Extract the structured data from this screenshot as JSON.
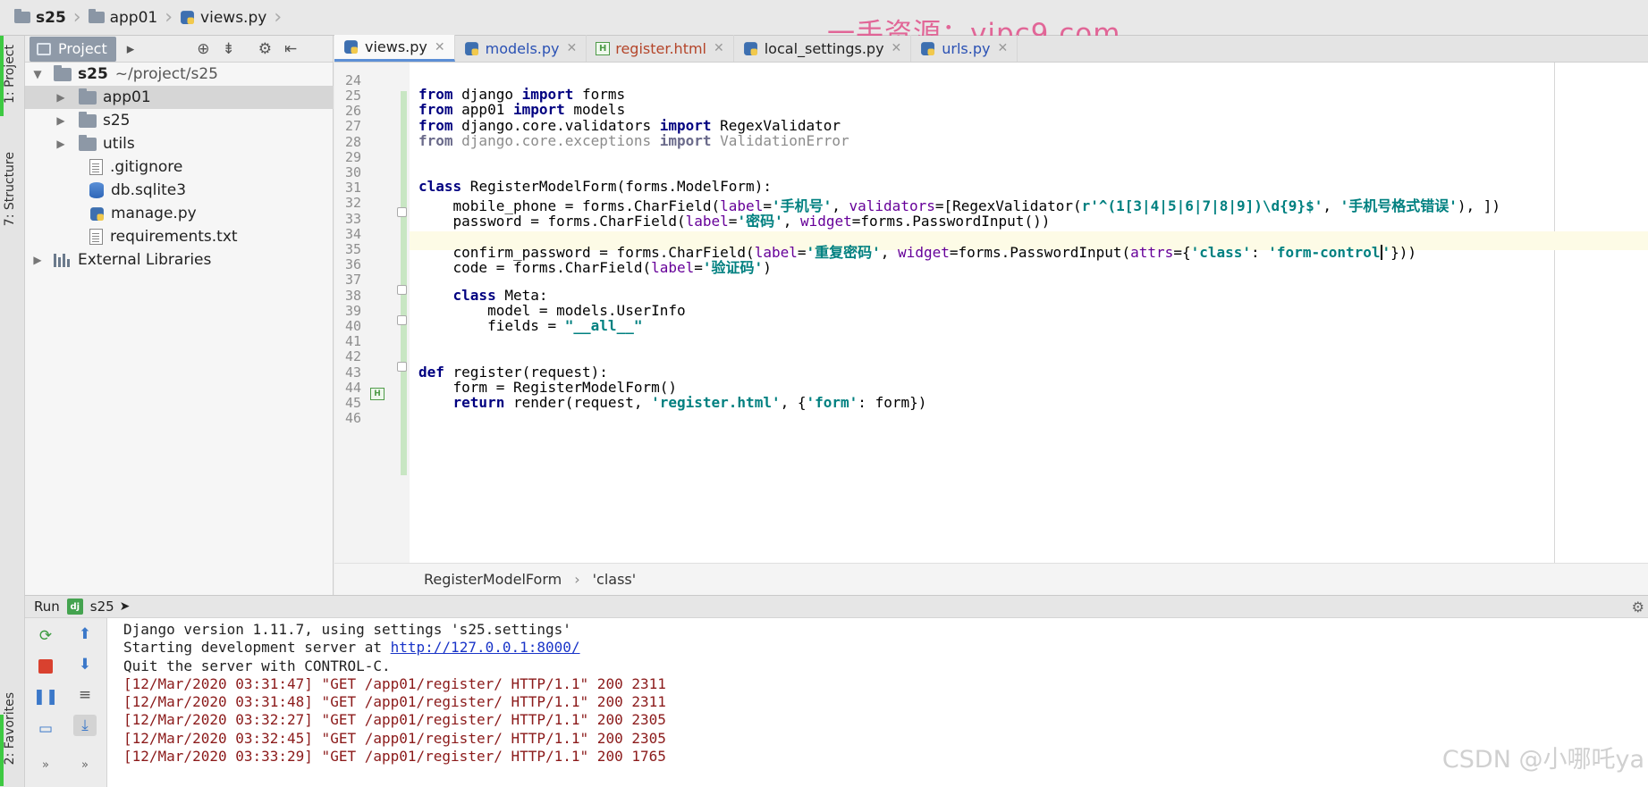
{
  "breadcrumb": {
    "items": [
      "s25",
      "app01",
      "views.py"
    ]
  },
  "watermark": "一手资源：vipc9.com",
  "side_tabs": {
    "project": "1: Project",
    "structure": "7: Structure",
    "favorites": "2: Favorites"
  },
  "project_panel": {
    "title": "Project",
    "root": {
      "name": "s25",
      "path": "~/project/s25"
    },
    "items": [
      {
        "name": "app01",
        "type": "folder"
      },
      {
        "name": "s25",
        "type": "folder"
      },
      {
        "name": "utils",
        "type": "folder"
      },
      {
        "name": ".gitignore",
        "type": "file"
      },
      {
        "name": "db.sqlite3",
        "type": "db"
      },
      {
        "name": "manage.py",
        "type": "python"
      },
      {
        "name": "requirements.txt",
        "type": "file"
      }
    ],
    "external": "External Libraries"
  },
  "editor_tabs": [
    {
      "label": "views.py",
      "active": true
    },
    {
      "label": "models.py",
      "active": false
    },
    {
      "label": "register.html",
      "active": false
    },
    {
      "label": "local_settings.py",
      "active": false
    },
    {
      "label": "urls.py",
      "active": false
    }
  ],
  "line_numbers": [
    "24",
    "25",
    "26",
    "27",
    "28",
    "29",
    "30",
    "31",
    "32",
    "33",
    "34",
    "35",
    "36",
    "37",
    "38",
    "39",
    "40",
    "41",
    "42",
    "43",
    "44",
    "45",
    "46"
  ],
  "code": {
    "l25": [
      "from",
      " django ",
      "import",
      " forms"
    ],
    "l26": [
      "from",
      " app01 ",
      "import",
      " models"
    ],
    "l27": [
      "from",
      " django.core.validators ",
      "import",
      " RegexValidator"
    ],
    "l28": [
      "from",
      " django.core.exceptions ",
      "import",
      " ValidationError"
    ],
    "l31": [
      "class",
      " RegisterModelForm(forms.ModelForm):"
    ],
    "l32": [
      "    mobile_phone = forms.CharField(",
      "label",
      "=",
      "'手机号'",
      ", ",
      "validators",
      "=[RegexValidator(",
      "r'^(1[3|4|5|6|7|8|9])\\d{9}$'",
      ", ",
      "'手机号格式错误'",
      "), ])"
    ],
    "l33": [
      "    password = forms.CharField(",
      "label",
      "=",
      "'密码'",
      ", ",
      "widget",
      "=forms.PasswordInput())"
    ],
    "l35": [
      "    confirm_password = forms.CharField(",
      "label",
      "=",
      "'重复密码'",
      ", ",
      "widget",
      "=forms.PasswordInput(",
      "attrs",
      "={",
      "'class'",
      ": ",
      "'form-control",
      "'",
      "}))"
    ],
    "l36": [
      "    code = forms.CharField(",
      "label",
      "=",
      "'验证码'",
      ")"
    ],
    "l38": [
      "    ",
      "class",
      " Meta:"
    ],
    "l39": [
      "        model = models.UserInfo"
    ],
    "l40": [
      "        fields = ",
      "\"__all__\""
    ],
    "l43": [
      "def",
      " register(request):"
    ],
    "l44": [
      "    form = RegisterModelForm()"
    ],
    "l45": [
      "    ",
      "return",
      " render(request, ",
      "'register.html'",
      ", {",
      "'form'",
      ": form})"
    ]
  },
  "editor_breadcrumb": [
    "RegisterModelForm",
    "'class'"
  ],
  "run_panel": {
    "label": "Run",
    "config": "s25",
    "console": [
      "Django version 1.11.7, using settings 's25.settings'",
      "Starting development server at ",
      "http://127.0.0.1:8000/",
      "Quit the server with CONTROL-C.",
      "[12/Mar/2020 03:31:47] \"GET /app01/register/ HTTP/1.1\" 200 2311",
      "[12/Mar/2020 03:31:48] \"GET /app01/register/ HTTP/1.1\" 200 2311",
      "[12/Mar/2020 03:32:27] \"GET /app01/register/ HTTP/1.1\" 200 2305",
      "[12/Mar/2020 03:32:45] \"GET /app01/register/ HTTP/1.1\" 200 2305",
      "[12/Mar/2020 03:33:29] \"GET /app01/register/ HTTP/1.1\" 200 1765"
    ]
  },
  "csdn_watermark": "CSDN @小哪吒ya",
  "colors": {
    "keyword": "#000080",
    "string": "#008080",
    "kwarg": "#660099",
    "log": "#8b1a1a",
    "link": "#1a35c8",
    "accent": "#3ec942"
  }
}
